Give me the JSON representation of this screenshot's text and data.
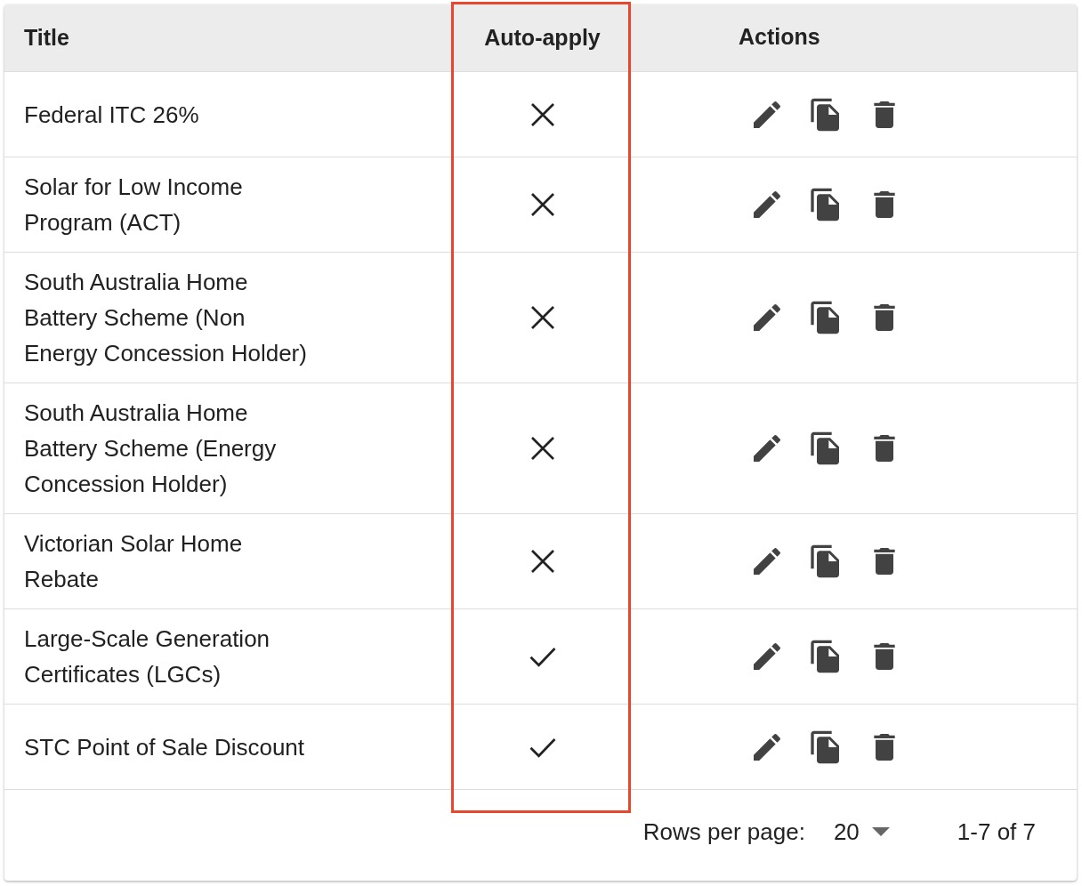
{
  "table": {
    "columns": [
      {
        "label": "Title",
        "highlighted": false
      },
      {
        "label": "Auto-apply",
        "highlighted": true
      },
      {
        "label": "Actions",
        "highlighted": false
      }
    ],
    "rows": [
      {
        "title": "Federal ITC 26%",
        "auto_apply": false
      },
      {
        "title": "Solar for Low Income Program (ACT)",
        "auto_apply": false
      },
      {
        "title": "South Australia Home Battery Scheme (Non Energy Concession Holder)",
        "auto_apply": false
      },
      {
        "title": "South Australia Home Battery Scheme (Energy Concession Holder)",
        "auto_apply": false
      },
      {
        "title": "Victorian Solar Home Rebate",
        "auto_apply": false
      },
      {
        "title": "Large-Scale Generation Certificates (LGCs)",
        "auto_apply": true
      },
      {
        "title": "STC Point of Sale Discount",
        "auto_apply": true
      }
    ]
  },
  "pagination": {
    "rows_per_page_label": "Rows per page:",
    "rows_per_page": "20",
    "range": "1-7 of 7"
  }
}
